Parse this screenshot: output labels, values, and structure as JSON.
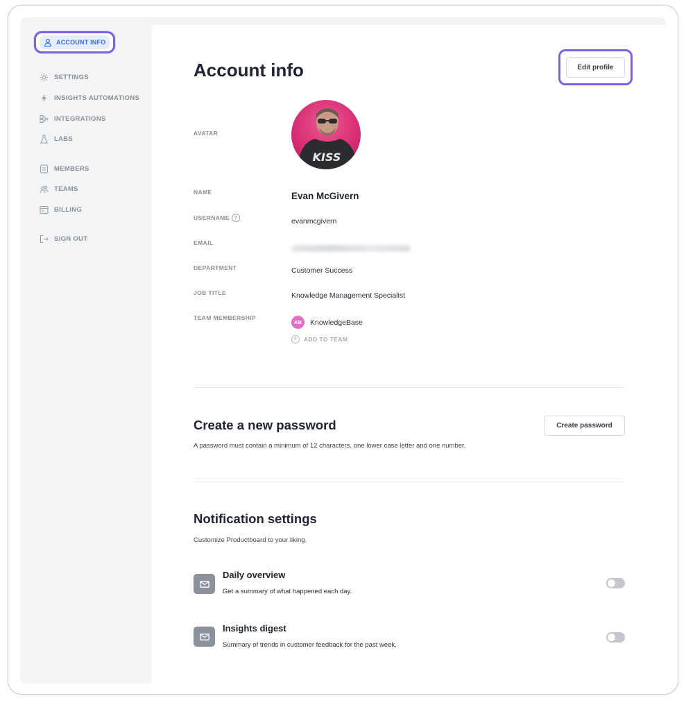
{
  "sidebar": {
    "active_item": {
      "label": "ACCOUNT INFO",
      "icon": "user-icon"
    },
    "items": [
      {
        "label": "SETTINGS",
        "icon": "gear-icon"
      },
      {
        "label": "INSIGHTS AUTOMATIONS",
        "icon": "lightning-icon"
      },
      {
        "label": "INTEGRATIONS",
        "icon": "integrations-icon"
      },
      {
        "label": "LABS",
        "icon": "flask-icon"
      },
      {
        "label": "MEMBERS",
        "icon": "members-icon"
      },
      {
        "label": "TEAMS",
        "icon": "teams-icon"
      },
      {
        "label": "BILLING",
        "icon": "billing-icon"
      },
      {
        "label": "SIGN OUT",
        "icon": "sign-out-icon"
      }
    ]
  },
  "account": {
    "title": "Account info",
    "edit_label": "Edit profile",
    "fields": {
      "avatar_label": "AVATAR",
      "name_label": "NAME",
      "name_value": "Evan McGivern",
      "username_label": "USERNAME",
      "username_value": "evanmcgivern",
      "email_label": "EMAIL",
      "department_label": "DEPARTMENT",
      "department_value": "Customer Success",
      "job_title_label": "JOB TITLE",
      "job_title_value": "Knowledge Management Specialist",
      "team_label": "TEAM MEMBERSHIP",
      "team_badge": "KB",
      "team_name": "KnowledgeBase",
      "add_team_label": "ADD TO TEAM"
    },
    "avatar_text": "KISS"
  },
  "password": {
    "title": "Create a new password",
    "description": "A password must contain a minimum of 12 characters, one lower case letter and one number.",
    "button_label": "Create password"
  },
  "notifications": {
    "title": "Notification settings",
    "description": "Customize Productboard to your liking.",
    "items": [
      {
        "title": "Daily overview",
        "description": "Get a summary of what happened each day.",
        "icon": "mail-icon",
        "enabled": false
      },
      {
        "title": "Insights digest",
        "description": "Summary of trends in customer feedback for the past week.",
        "icon": "mail-icon",
        "enabled": false
      }
    ]
  },
  "colors": {
    "highlight": "#7b61e0",
    "active_text": "#2f6fe6",
    "team_badge": "#e36fc3"
  }
}
